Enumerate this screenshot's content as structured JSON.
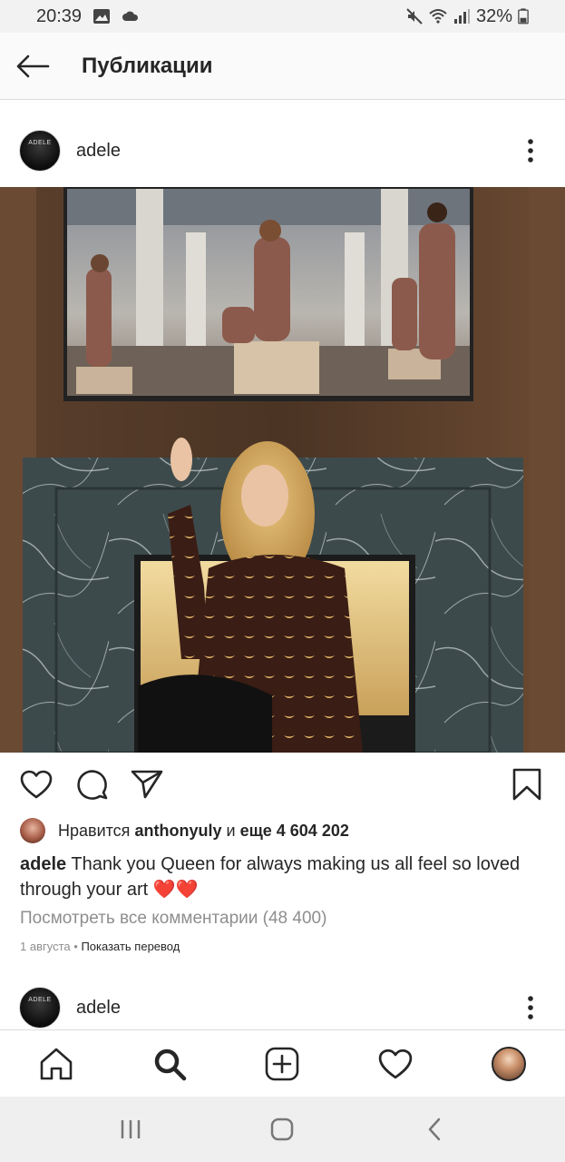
{
  "status_bar": {
    "time": "20:39",
    "battery": "32%",
    "icons": [
      "image-icon",
      "cloud-icon",
      "mute-icon",
      "wifi-icon",
      "signal-icon",
      "battery-icon"
    ]
  },
  "header": {
    "title": "Публикации",
    "back_icon": "arrow-left-icon"
  },
  "post": {
    "username": "adele",
    "avatar_text": "ADELE",
    "liked_by_prefix": "Нравится",
    "liked_by_user": "anthonyuly",
    "liked_by_and": "и",
    "liked_by_rest": "еще 4 604 202",
    "caption_user": "adele",
    "caption_text": "Thank you Queen for always making us all feel so loved through your art",
    "caption_emoji": "❤️❤️",
    "view_comments": "Посмотреть все комментарии (48 400)",
    "date": "1 августа",
    "separator": "•",
    "translate": "Показать перевод"
  },
  "next_post": {
    "username": "adele",
    "avatar_text": "ADELE"
  },
  "bottom_nav": {
    "items": [
      "home-icon",
      "search-icon",
      "add-post-icon",
      "activity-heart-icon",
      "profile-avatar"
    ]
  },
  "colors": {
    "text": "#262626",
    "secondary": "#8e8e8e",
    "heart": "#ed4956",
    "border": "#dbdbdb"
  }
}
